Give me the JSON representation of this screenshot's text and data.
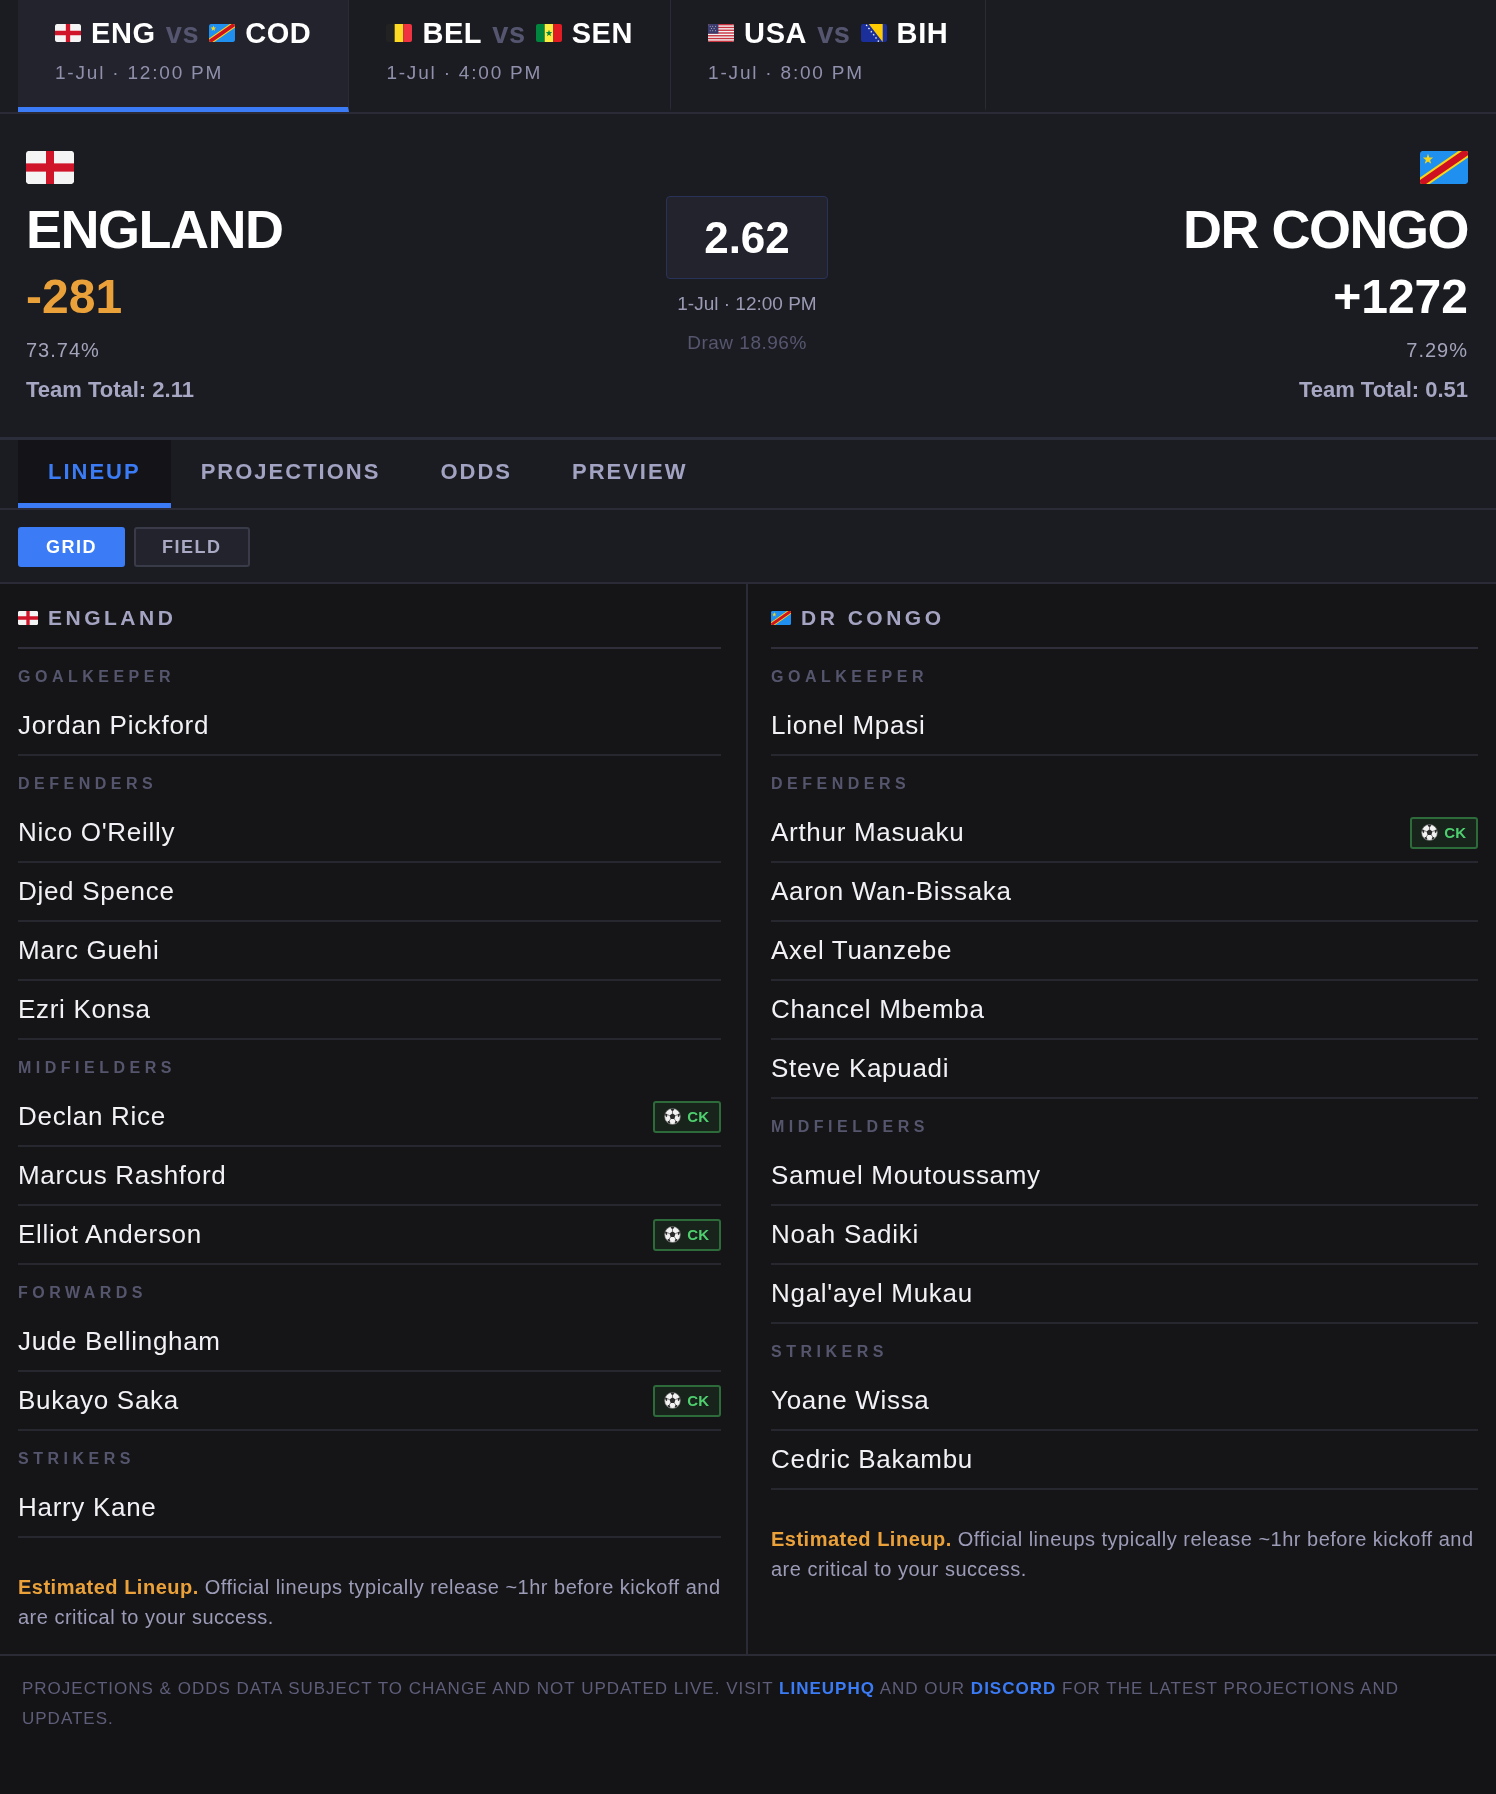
{
  "matches": [
    {
      "home": {
        "code": "ENG",
        "flag": {
          "kind": "england"
        }
      },
      "vs": "vs",
      "away": {
        "code": "COD",
        "flag": {
          "kind": "dr-congo"
        }
      },
      "time": "1-Jul · 12:00 PM",
      "selected": true
    },
    {
      "home": {
        "code": "BEL",
        "flag": {
          "kind": "belgium"
        }
      },
      "vs": "vs",
      "away": {
        "code": "SEN",
        "flag": {
          "kind": "senegal"
        }
      },
      "time": "1-Jul · 4:00 PM",
      "selected": false
    },
    {
      "home": {
        "code": "USA",
        "flag": {
          "kind": "usa"
        }
      },
      "vs": "vs",
      "away": {
        "code": "BIH",
        "flag": {
          "kind": "bosnia"
        }
      },
      "time": "1-Jul · 8:00 PM",
      "selected": false
    }
  ],
  "matchup": {
    "home": {
      "flag": {
        "kind": "england"
      },
      "name": "ENGLAND",
      "odds": "-281",
      "favorite": true,
      "win_pct": "73.74%",
      "team_total": "Team Total: 2.11"
    },
    "center": {
      "total": "2.62",
      "time": "1-Jul · 12:00 PM",
      "draw": "Draw 18.96%"
    },
    "away": {
      "flag": {
        "kind": "dr-congo"
      },
      "name": "DR CONGO",
      "odds": "+1272",
      "favorite": false,
      "win_pct": "7.29%",
      "team_total": "Team Total: 0.51"
    }
  },
  "tabs": [
    {
      "label": "LINEUP",
      "selected": true
    },
    {
      "label": "PROJECTIONS",
      "selected": false
    },
    {
      "label": "ODDS",
      "selected": false
    },
    {
      "label": "PREVIEW",
      "selected": false
    }
  ],
  "view_toggle": [
    {
      "label": "GRID",
      "selected": true
    },
    {
      "label": "FIELD",
      "selected": false
    }
  ],
  "lineups": [
    {
      "flag": {
        "kind": "england"
      },
      "team": "ENGLAND",
      "groups": [
        {
          "position": "GOALKEEPER",
          "players": [
            {
              "name": "Jordan Pickford"
            }
          ]
        },
        {
          "position": "DEFENDERS",
          "players": [
            {
              "name": "Nico O'Reilly"
            },
            {
              "name": "Djed Spence"
            },
            {
              "name": "Marc Guehi"
            },
            {
              "name": "Ezri Konsa"
            }
          ]
        },
        {
          "position": "MIDFIELDERS",
          "players": [
            {
              "name": "Declan Rice",
              "badge": "CK"
            },
            {
              "name": "Marcus Rashford"
            },
            {
              "name": "Elliot Anderson",
              "badge": "CK"
            }
          ]
        },
        {
          "position": "FORWARDS",
          "players": [
            {
              "name": "Jude Bellingham"
            },
            {
              "name": "Bukayo Saka",
              "badge": "CK"
            }
          ]
        },
        {
          "position": "STRIKERS",
          "players": [
            {
              "name": "Harry Kane"
            }
          ]
        }
      ],
      "note": "**Estimated Lineup.** Official lineups typically release ~1hr before kickoff and are critical to your success."
    },
    {
      "flag": {
        "kind": "dr-congo"
      },
      "team": "DR CONGO",
      "groups": [
        {
          "position": "GOALKEEPER",
          "players": [
            {
              "name": "Lionel Mpasi"
            }
          ]
        },
        {
          "position": "DEFENDERS",
          "players": [
            {
              "name": "Arthur Masuaku",
              "badge": "CK"
            },
            {
              "name": "Aaron Wan-Bissaka"
            },
            {
              "name": "Axel Tuanzebe"
            },
            {
              "name": "Chancel Mbemba"
            },
            {
              "name": "Steve Kapuadi"
            }
          ]
        },
        {
          "position": "MIDFIELDERS",
          "players": [
            {
              "name": "Samuel Moutoussamy"
            },
            {
              "name": "Noah Sadiki"
            },
            {
              "name": "Ngal'ayel Mukau"
            }
          ]
        },
        {
          "position": "STRIKERS",
          "players": [
            {
              "name": "Yoane Wissa"
            },
            {
              "name": "Cedric Bakambu"
            }
          ]
        }
      ],
      "note": "**Estimated Lineup.** Official lineups typically release ~1hr before kickoff and are critical to your success."
    }
  ],
  "footer": {
    "parts": [
      {
        "kind": "text",
        "text": "PROJECTIONS & ODDS DATA SUBJECT TO CHANGE AND NOT UPDATED LIVE. VISIT"
      },
      {
        "kind": "link",
        "text": "LINEUPHQ"
      },
      {
        "kind": "text",
        "text": "AND OUR"
      },
      {
        "kind": "link",
        "text": "DISCORD"
      },
      {
        "kind": "text",
        "text": "FOR THE LATEST PROJECTIONS AND UPDATES."
      }
    ]
  }
}
